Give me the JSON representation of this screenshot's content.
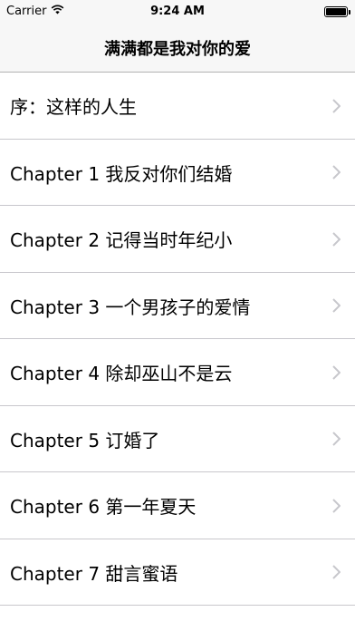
{
  "status_bar": {
    "carrier": "Carrier",
    "time": "9:24 AM",
    "battery_level": 1.0
  },
  "nav": {
    "title": "满满都是我对你的爱"
  },
  "chapters": [
    {
      "label": "序：这样的人生"
    },
    {
      "label": "Chapter 1 我反对你们结婚"
    },
    {
      "label": "Chapter 2 记得当时年纪小"
    },
    {
      "label": "Chapter 3 一个男孩子的爱情"
    },
    {
      "label": "Chapter 4 除却巫山不是云"
    },
    {
      "label": "Chapter 5 订婚了"
    },
    {
      "label": "Chapter 6 第一年夏天"
    },
    {
      "label": "Chapter 7 甜言蜜语"
    }
  ],
  "colors": {
    "bar_background": "#f7f7f7",
    "separator": "#c8c7cc",
    "chevron": "#c7c7cc"
  },
  "icons": {
    "wifi": "wifi-icon",
    "battery": "battery-icon",
    "disclosure": "chevron-right-icon"
  }
}
